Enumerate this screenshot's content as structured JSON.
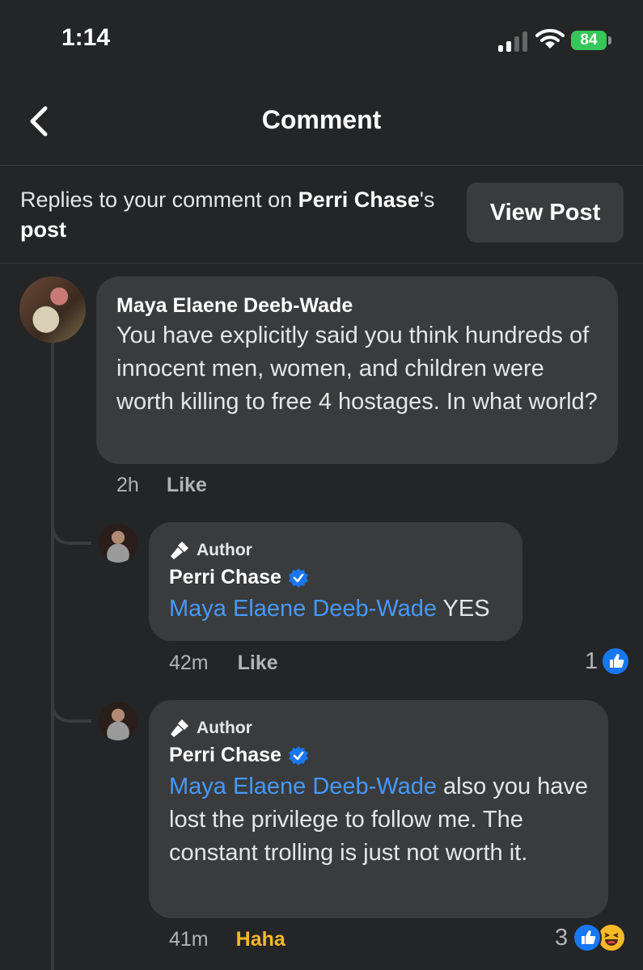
{
  "status": {
    "time": "1:14",
    "battery": "84"
  },
  "header": {
    "title": "Comment"
  },
  "context": {
    "prefix": "Replies to your comment on ",
    "post_owner": "Perri Chase",
    "suffix_possessive": "'s",
    "post_word": "post",
    "view_post_label": "View Post"
  },
  "comments": [
    {
      "author": "Maya Elaene Deeb-Wade",
      "text": "You have explicitly said you think hundreds of innocent men, women, and children were worth killing to free 4 hostages. In what world?",
      "time": "2h",
      "action": "Like"
    }
  ],
  "replies": [
    {
      "badge": "Author",
      "author": "Perri Chase",
      "mention": "Maya Elaene Deeb-Wade",
      "text": " YES",
      "time": "42m",
      "action": "Like",
      "reaction_count": "1",
      "reactions": [
        "like-icon"
      ]
    },
    {
      "badge": "Author",
      "author": "Perri Chase",
      "mention": "Maya Elaene Deeb-Wade",
      "text": " also you have  lost the privilege to follow me. The constant trolling is just not worth it.",
      "time": "41m",
      "action": "Haha",
      "reaction_count": "3",
      "reactions": [
        "like-icon",
        "haha-icon"
      ]
    }
  ],
  "colors": {
    "background": "#242526",
    "bubble": "#3a3b3c",
    "mention": "#4599ff",
    "verified": "#1877f2",
    "haha": "#f7b928"
  }
}
